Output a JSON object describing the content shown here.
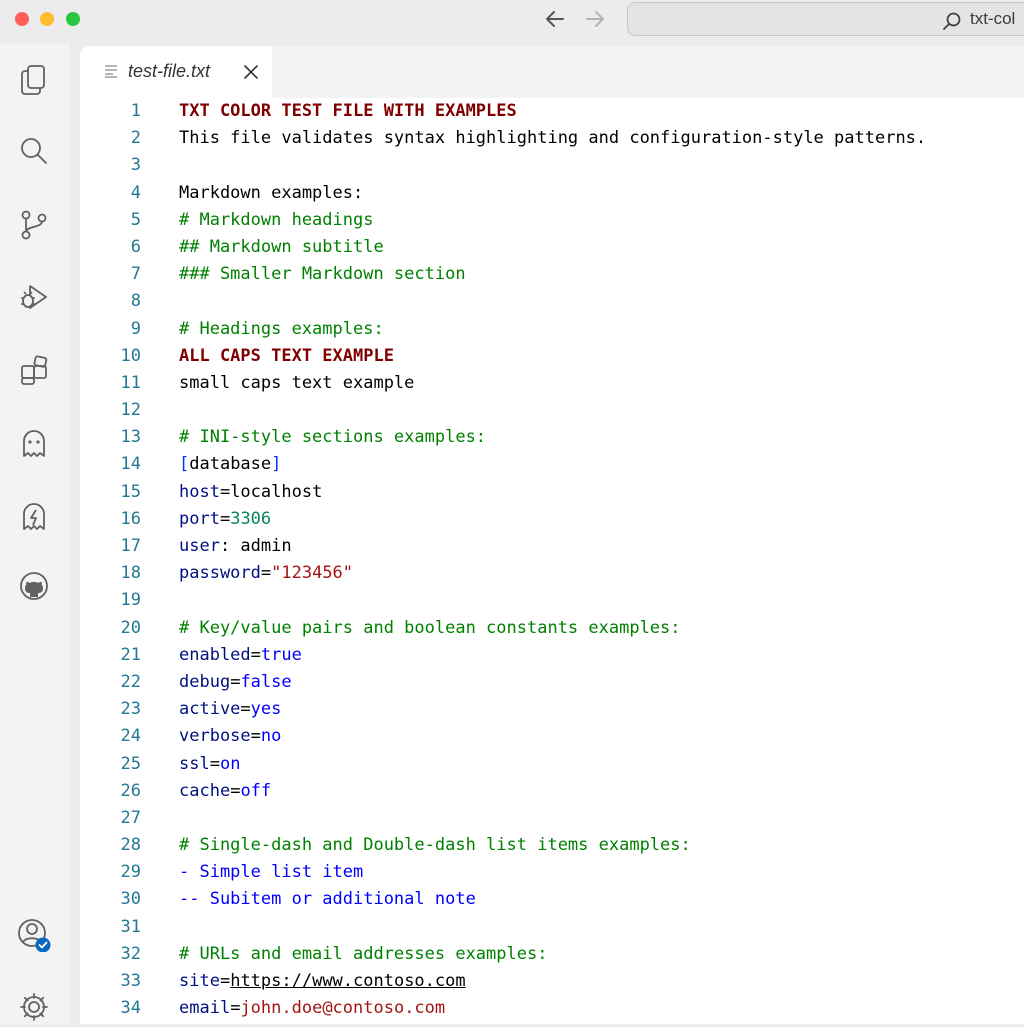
{
  "window": {
    "command_center_text": "txt-col"
  },
  "tab": {
    "filename": "test-file.txt"
  },
  "lines": [
    {
      "n": "1",
      "parts": [
        {
          "t": "TXT COLOR TEST FILE WITH EXAMPLES",
          "k": "head"
        }
      ]
    },
    {
      "n": "2",
      "parts": [
        {
          "t": "This file validates syntax highlighting and configuration-style patterns.",
          "k": "plain"
        }
      ]
    },
    {
      "n": "3",
      "parts": []
    },
    {
      "n": "4",
      "parts": [
        {
          "t": "Markdown examples:",
          "k": "plain"
        }
      ]
    },
    {
      "n": "5",
      "parts": [
        {
          "t": "# Markdown headings",
          "k": "comment"
        }
      ]
    },
    {
      "n": "6",
      "parts": [
        {
          "t": "## Markdown subtitle",
          "k": "comment"
        }
      ]
    },
    {
      "n": "7",
      "parts": [
        {
          "t": "### Smaller Markdown section",
          "k": "comment"
        }
      ]
    },
    {
      "n": "8",
      "parts": []
    },
    {
      "n": "9",
      "parts": [
        {
          "t": "# Headings examples:",
          "k": "comment"
        }
      ]
    },
    {
      "n": "10",
      "parts": [
        {
          "t": "ALL CAPS TEXT EXAMPLE",
          "k": "head"
        }
      ]
    },
    {
      "n": "11",
      "parts": [
        {
          "t": "small caps text example",
          "k": "plain"
        }
      ]
    },
    {
      "n": "12",
      "parts": []
    },
    {
      "n": "13",
      "parts": [
        {
          "t": "# INI-style sections examples:",
          "k": "comment"
        }
      ]
    },
    {
      "n": "14",
      "parts": [
        {
          "t": "[",
          "k": "bracket"
        },
        {
          "t": "database",
          "k": "plain"
        },
        {
          "t": "]",
          "k": "bracket"
        }
      ]
    },
    {
      "n": "15",
      "parts": [
        {
          "t": "host",
          "k": "key"
        },
        {
          "t": "=localhost",
          "k": "plain"
        }
      ]
    },
    {
      "n": "16",
      "parts": [
        {
          "t": "port",
          "k": "key"
        },
        {
          "t": "=",
          "k": "plain"
        },
        {
          "t": "3306",
          "k": "num"
        }
      ]
    },
    {
      "n": "17",
      "parts": [
        {
          "t": "user",
          "k": "key"
        },
        {
          "t": ": admin",
          "k": "plain"
        }
      ]
    },
    {
      "n": "18",
      "parts": [
        {
          "t": "password",
          "k": "key"
        },
        {
          "t": "=",
          "k": "plain"
        },
        {
          "t": "\"123456\"",
          "k": "str"
        }
      ]
    },
    {
      "n": "19",
      "parts": []
    },
    {
      "n": "20",
      "parts": [
        {
          "t": "# Key/value pairs and boolean constants examples:",
          "k": "comment"
        }
      ]
    },
    {
      "n": "21",
      "parts": [
        {
          "t": "enabled",
          "k": "key"
        },
        {
          "t": "=",
          "k": "plain"
        },
        {
          "t": "true",
          "k": "kw"
        }
      ]
    },
    {
      "n": "22",
      "parts": [
        {
          "t": "debug",
          "k": "key"
        },
        {
          "t": "=",
          "k": "plain"
        },
        {
          "t": "false",
          "k": "kw"
        }
      ]
    },
    {
      "n": "23",
      "parts": [
        {
          "t": "active",
          "k": "key"
        },
        {
          "t": "=",
          "k": "plain"
        },
        {
          "t": "yes",
          "k": "kw"
        }
      ]
    },
    {
      "n": "24",
      "parts": [
        {
          "t": "verbose",
          "k": "key"
        },
        {
          "t": "=",
          "k": "plain"
        },
        {
          "t": "no",
          "k": "kw"
        }
      ]
    },
    {
      "n": "25",
      "parts": [
        {
          "t": "ssl",
          "k": "key"
        },
        {
          "t": "=",
          "k": "plain"
        },
        {
          "t": "on",
          "k": "kw"
        }
      ]
    },
    {
      "n": "26",
      "parts": [
        {
          "t": "cache",
          "k": "key"
        },
        {
          "t": "=",
          "k": "plain"
        },
        {
          "t": "off",
          "k": "kw"
        }
      ]
    },
    {
      "n": "27",
      "parts": []
    },
    {
      "n": "28",
      "parts": [
        {
          "t": "# Single-dash and Double-dash list items examples:",
          "k": "comment"
        }
      ]
    },
    {
      "n": "29",
      "parts": [
        {
          "t": "- Simple list item",
          "k": "kw"
        }
      ]
    },
    {
      "n": "30",
      "parts": [
        {
          "t": "-- Subitem or additional note",
          "k": "kw"
        }
      ]
    },
    {
      "n": "31",
      "parts": []
    },
    {
      "n": "32",
      "parts": [
        {
          "t": "# URLs and email addresses examples:",
          "k": "comment"
        }
      ]
    },
    {
      "n": "33",
      "parts": [
        {
          "t": "site",
          "k": "key"
        },
        {
          "t": "=",
          "k": "plain"
        },
        {
          "t": "https://www.contoso.com",
          "k": "url"
        }
      ]
    },
    {
      "n": "34",
      "parts": [
        {
          "t": "email",
          "k": "key"
        },
        {
          "t": "=",
          "k": "plain"
        },
        {
          "t": "john.doe@contoso.com",
          "k": "str"
        }
      ]
    }
  ],
  "colors": {
    "line_number": "#237893",
    "heading": "#800000",
    "comment": "#008000",
    "key": "#001080",
    "keyword": "#0000ff",
    "number": "#098658",
    "string": "#a31515",
    "bracket": "#0431fa",
    "accounts_badge": "#0a66c2"
  },
  "icons": {
    "activity_bar": [
      "explorer-icon",
      "search-icon",
      "source-control-icon",
      "run-debug-icon",
      "extensions-icon",
      "ghost-icon",
      "live-share-icon",
      "github-icon",
      "accounts-icon",
      "manage-gear-icon"
    ]
  }
}
